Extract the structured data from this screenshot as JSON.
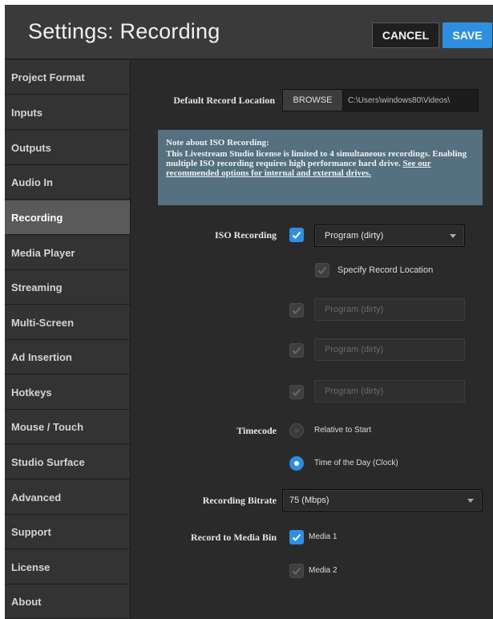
{
  "header": {
    "title": "Settings: Recording",
    "cancel_label": "CANCEL",
    "save_label": "SAVE"
  },
  "sidebar": {
    "items": [
      {
        "label": "Project Format",
        "active": false
      },
      {
        "label": "Inputs",
        "active": false
      },
      {
        "label": "Outputs",
        "active": false
      },
      {
        "label": "Audio In",
        "active": false
      },
      {
        "label": "Recording",
        "active": true
      },
      {
        "label": "Media Player",
        "active": false
      },
      {
        "label": "Streaming",
        "active": false
      },
      {
        "label": "Multi-Screen",
        "active": false
      },
      {
        "label": "Ad Insertion",
        "active": false
      },
      {
        "label": "Hotkeys",
        "active": false
      },
      {
        "label": "Mouse / Touch",
        "active": false
      },
      {
        "label": "Studio Surface",
        "active": false
      },
      {
        "label": "Advanced",
        "active": false
      },
      {
        "label": "Support",
        "active": false
      },
      {
        "label": "License",
        "active": false
      },
      {
        "label": "About",
        "active": false
      }
    ]
  },
  "record_location": {
    "label": "Default Record Location",
    "browse_label": "BROWSE",
    "path": "C:\\Users\\windows80\\Videos\\"
  },
  "note": {
    "title": "Note about ISO Recording:",
    "body": "This Livestream Studio license is limited to 4 simultaneous recordings. Enabling multiple ISO recording requires high performance hard drive. ",
    "link": "See our recommended options for internal and external drives."
  },
  "iso": {
    "label": "ISO Recording",
    "primary_select": "Program (dirty)",
    "specify_location_label": "Specify Record Location",
    "extra_selects": [
      "Program (dirty)",
      "Program (dirty)",
      "Program (dirty)"
    ]
  },
  "timecode": {
    "label": "Timecode",
    "options": [
      {
        "label": "Relative to Start",
        "selected": false
      },
      {
        "label": "Time of the Day (Clock)",
        "selected": true
      }
    ]
  },
  "bitrate": {
    "label": "Recording Bitrate",
    "value": "75 (Mbps)"
  },
  "media_bin": {
    "label": "Record to Media Bin",
    "options": [
      {
        "label": "Media 1",
        "checked": true
      },
      {
        "label": "Media 2",
        "checked": false
      }
    ]
  },
  "colors": {
    "accent": "#2e8fe0",
    "background": "#2a2a2a",
    "note_background": "#55707e"
  }
}
